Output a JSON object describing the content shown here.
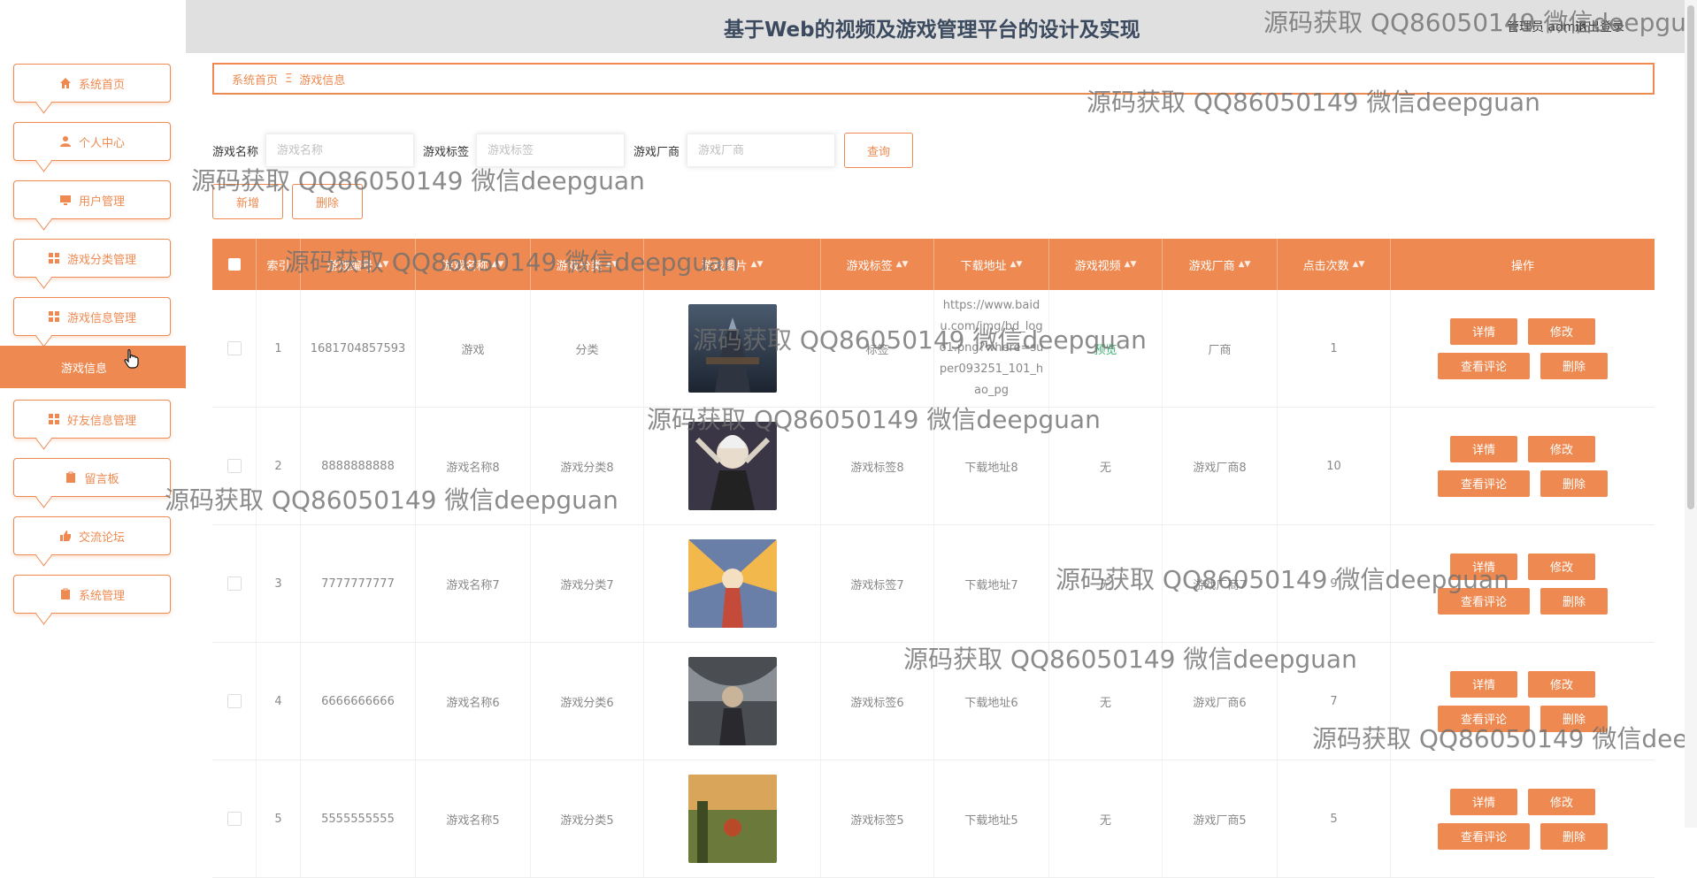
{
  "header": {
    "title": "基于Web的视频及游戏管理平台的设计及实现",
    "user_text": "管理员 admin",
    "logout_label": "退出登录"
  },
  "sidebar": {
    "items": [
      {
        "label": "系统首页",
        "icon": "home-icon"
      },
      {
        "label": "个人中心",
        "icon": "user-icon"
      },
      {
        "label": "用户管理",
        "icon": "monitor-icon"
      },
      {
        "label": "游戏分类管理",
        "icon": "grid-icon"
      },
      {
        "label": "游戏信息管理",
        "icon": "grid-icon"
      },
      {
        "label": "好友信息管理",
        "icon": "grid-icon"
      },
      {
        "label": "留言板",
        "icon": "clipboard-icon"
      },
      {
        "label": "交流论坛",
        "icon": "thumb-icon"
      },
      {
        "label": "系统管理",
        "icon": "clipboard-icon"
      }
    ],
    "active_sub": "游戏信息"
  },
  "breadcrumb": {
    "home": "系统首页",
    "separator": "Ξ",
    "current": "游戏信息"
  },
  "search": {
    "name_label": "游戏名称",
    "name_placeholder": "游戏名称",
    "tag_label": "游戏标签",
    "tag_placeholder": "游戏标签",
    "vendor_label": "游戏厂商",
    "vendor_placeholder": "游戏厂商",
    "query_label": "查询"
  },
  "actions": {
    "add_label": "新增",
    "delete_label": "删除"
  },
  "table": {
    "headers": [
      "索引",
      "游戏编号",
      "游戏名称",
      "游戏分类",
      "游戏图片",
      "游戏标签",
      "下载地址",
      "游戏视频",
      "游戏厂商",
      "点击次数",
      "操作"
    ],
    "op_labels": {
      "detail": "详情",
      "edit": "修改",
      "comments": "查看评论",
      "delete": "删除"
    },
    "rows": [
      {
        "index": "1",
        "code": "1681704857593",
        "name": "游戏",
        "category": "分类",
        "tag": "标签",
        "download": "https://www.baidu.com/img/bd_logo1.png?where=super093251_101_hao_pg",
        "video": "预览",
        "vendor": "厂商",
        "clicks": "1"
      },
      {
        "index": "2",
        "code": "8888888888",
        "name": "游戏名称8",
        "category": "游戏分类8",
        "tag": "游戏标签8",
        "download": "下载地址8",
        "video": "无",
        "vendor": "游戏厂商8",
        "clicks": "10"
      },
      {
        "index": "3",
        "code": "7777777777",
        "name": "游戏名称7",
        "category": "游戏分类7",
        "tag": "游戏标签7",
        "download": "下载地址7",
        "video": "无",
        "vendor": "游戏厂商7",
        "clicks": "9"
      },
      {
        "index": "4",
        "code": "6666666666",
        "name": "游戏名称6",
        "category": "游戏分类6",
        "tag": "游戏标签6",
        "download": "下载地址6",
        "video": "无",
        "vendor": "游戏厂商6",
        "clicks": "7"
      },
      {
        "index": "5",
        "code": "5555555555",
        "name": "游戏名称5",
        "category": "游戏分类5",
        "tag": "游戏标签5",
        "download": "下载地址5",
        "video": "无",
        "vendor": "游戏厂商5",
        "clicks": "5"
      }
    ]
  },
  "watermark": "源码获取 QQ86050149 微信deepguan",
  "colors": {
    "accent": "#ee8a51",
    "header_bg": "#e0e0e0"
  }
}
